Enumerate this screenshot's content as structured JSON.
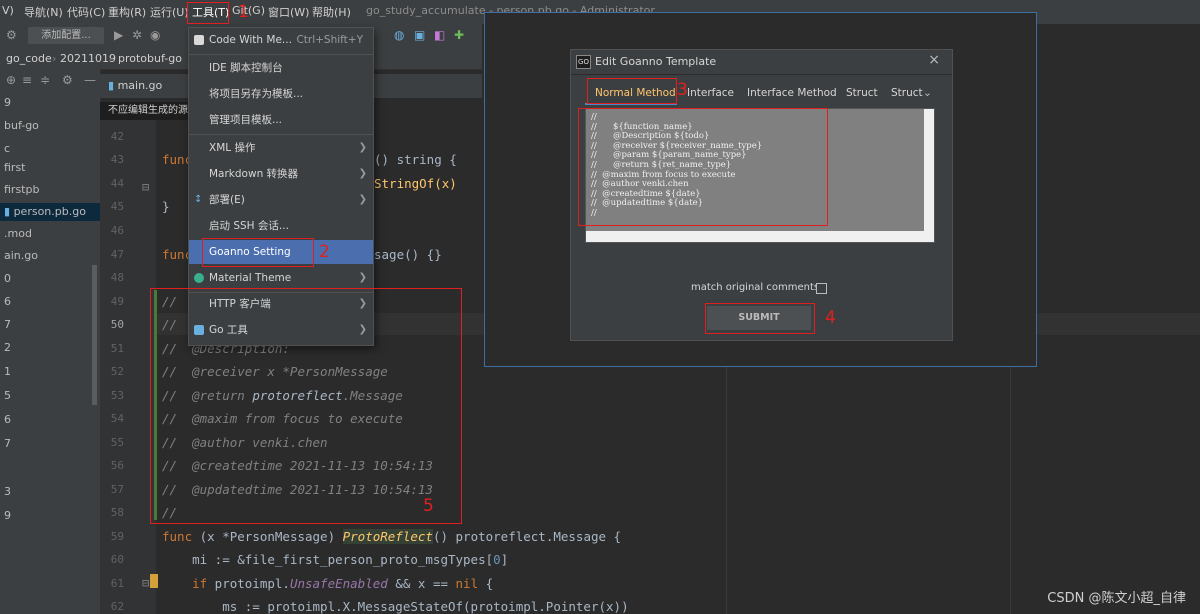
{
  "menubar": {
    "items": [
      "V)",
      "导航(N)",
      "代码(C)",
      "重构(R)",
      "运行(U)",
      "工具(T)",
      "Git(G)",
      "窗口(W)",
      "帮助(H)"
    ],
    "window_title": "go_study_accumulate - person.pb.go - Administrator"
  },
  "toolbar": {
    "add_config_label": "添加配置..."
  },
  "breadcrumb": [
    "go_code",
    "20211019",
    "protobuf-go"
  ],
  "project_tree": {
    "items": [
      "9",
      "buf-go",
      "c",
      "first",
      "firstpb",
      "person.pb.go",
      ".mod",
      "ain.go",
      "0",
      "6",
      "7",
      "2",
      "1",
      "5",
      "6",
      "7",
      "3",
      "9"
    ],
    "selected": "person.pb.go"
  },
  "editor": {
    "tab_label": "main.go",
    "notice": "不应编辑生成的源文",
    "line_numbers": [
      "42",
      "43",
      "44",
      "45",
      "46",
      "47",
      "48",
      "49",
      "50",
      "51",
      "52",
      "53",
      "54",
      "55",
      "56",
      "57",
      "58",
      "59",
      "60",
      "61",
      "62"
    ],
    "current_line": "50",
    "lines": {
      "l43a": "func",
      "l43b": "() string {",
      "l44": "StringOf(x)",
      "l45": "}",
      "l47a": "func",
      "l47b": "sage() {}",
      "l49": "//",
      "l50": "//",
      "l51": "//  @Description:",
      "l52": "//  @receiver x *PersonMessage",
      "l53a": "//  @return ",
      "l53b": "protoreflect",
      "l53c": ".Message",
      "l54": "//  @maxim from focus to execute",
      "l55": "//  @author venki.chen",
      "l56": "//  @createdtime 2021-11-13 10:54:13",
      "l57": "//  @updatedtime 2021-11-13 10:54:13",
      "l58": "//",
      "l59a": "func",
      "l59b": " (x *PersonMessage) ",
      "l59c": "ProtoReflect",
      "l59d": "() protoreflect.Message {",
      "l60a": "    mi := &file_first_person_proto_msgTypes[",
      "l60b": "0",
      "l60c": "]",
      "l61a": "    if",
      "l61b": " protoimpl.",
      "l61c": "UnsafeEnabled",
      "l61d": " && x == ",
      "l61e": "nil",
      "l61f": " {",
      "l62": "        ms := protoimpl.X.MessageStateOf(protoimpl.Pointer(x))"
    }
  },
  "tools_menu": {
    "code_with_me": "Code With Me...",
    "code_with_me_shortcut": "Ctrl+Shift+Y",
    "ide_console": "IDE 脚本控制台",
    "save_as_template": "将项目另存为模板...",
    "manage_templates": "管理项目模板...",
    "xml": "XML 操作",
    "markdown": "Markdown 转换器",
    "deploy": "部署(E)",
    "ssh": "启动 SSH 会话...",
    "goanno": "Goanno Setting",
    "material": "Material Theme",
    "http": "HTTP 客户端",
    "go_tools": "Go 工具"
  },
  "dialog": {
    "logo": "GO",
    "title": "Edit Goanno Template",
    "close": "×",
    "tabs": [
      "Normal Method",
      "Interface",
      "Interface Method",
      "Struct",
      "Struct"
    ],
    "active_tab": "Normal Method",
    "template_text": "//\n//      ${function_name}\n//      @Description ${todo}\n//      @receiver ${receiver_name_type}\n//      @param ${param_name_type}\n//      @return ${ret_name_type}\n//  @maxim from focus to execute\n//  @author venki.chen\n//  @createdtime ${date}\n//  @updatedtime ${date}\n//",
    "match_label": "match original comments",
    "match_checked": false,
    "submit_label": "SUBMIT"
  },
  "annotations": [
    "1",
    "2",
    "3",
    "4",
    "5"
  ],
  "watermark": "CSDN @陈文小超_自律",
  "colors": {
    "annotation": "#e02020",
    "selection": "#4b6eaf",
    "accent": "#ffc66d"
  }
}
